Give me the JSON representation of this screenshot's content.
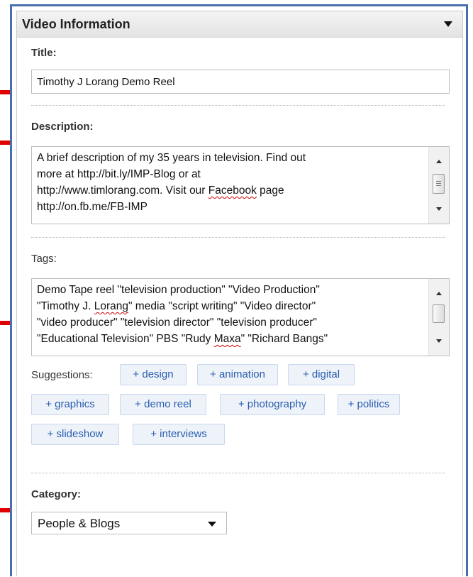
{
  "panel": {
    "title": "Video Information"
  },
  "title_field": {
    "label": "Title:",
    "value": "Timothy J Lorang Demo Reel"
  },
  "description_field": {
    "label": "Description:",
    "lines": [
      "A brief description of my 35 years in television. Find out",
      "more at http://bit.ly/IMP-Blog or at",
      "http://www.timlorang.com. Visit our ",
      "http://on.fb.me/FB-IMP"
    ],
    "misspelled_word": "Facebook",
    "line3_suffix": " page"
  },
  "tags_field": {
    "label": "Tags:",
    "lines": [
      "Demo Tape reel \"television production\" \"Video Production\"",
      "\"Timothy J. ",
      "\"video producer\" \"television director\" \"television producer\"",
      "\"Educational Television\" PBS \"Rudy "
    ],
    "line2_misspelled": "Lorang",
    "line2_suffix": "\" media \"script writing\" \"Video director\"",
    "line4_misspelled": "Maxa",
    "line4_suffix": "\" \"Richard Bangs\""
  },
  "suggestions": {
    "label": "Suggestions:",
    "items": [
      "+ design",
      "+ animation",
      "+ digital",
      "+ graphics",
      "+ demo reel",
      "+ photography",
      "+ politics",
      "+ slideshow",
      "+ interviews"
    ]
  },
  "category_field": {
    "label": "Category:",
    "selected": "People & Blogs"
  },
  "colors": {
    "frame_border": "#4a6fb0",
    "annotation_arrow": "#e00000",
    "chip_text": "#2a5db0"
  },
  "icons": [
    "dropdown-caret-icon",
    "scroll-up-icon",
    "scroll-down-icon",
    "annotation-arrow-icon"
  ]
}
